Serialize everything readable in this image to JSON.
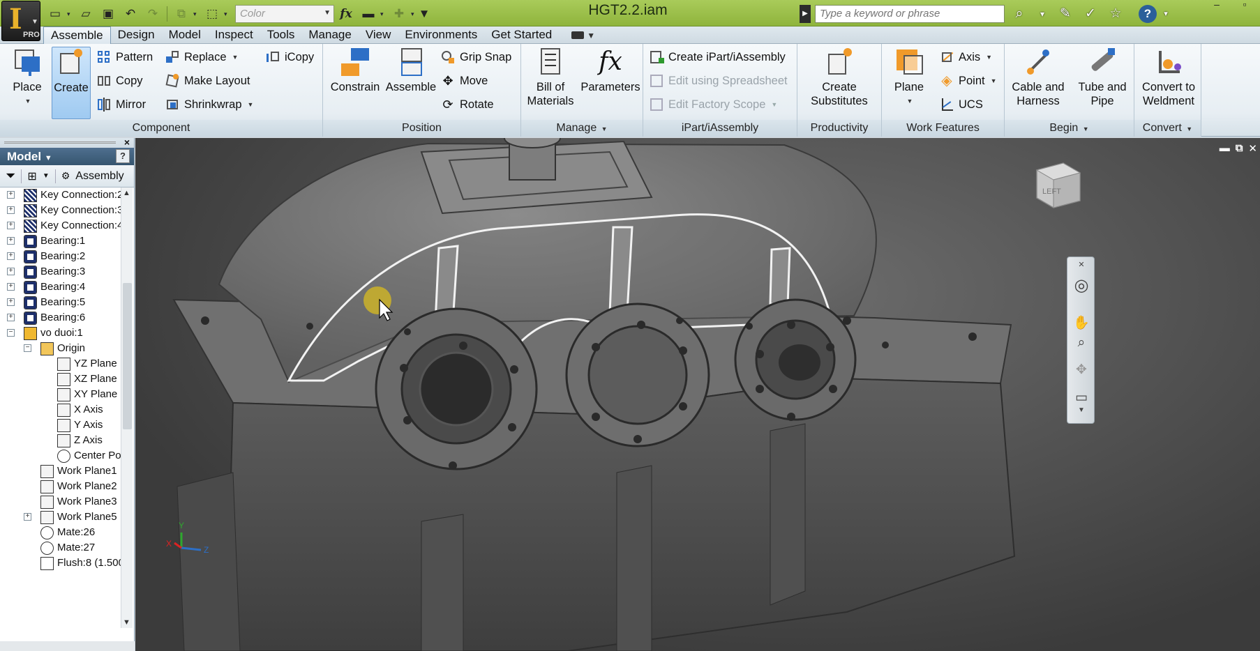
{
  "app": {
    "logo_letter": "I",
    "logo_badge": "PRO",
    "doc_title": "HGT2.2.iam"
  },
  "quick_access": {
    "color_placeholder": "Color",
    "fx": "fx"
  },
  "help": {
    "search_placeholder": "Type a keyword or phrase",
    "help_glyph": "?"
  },
  "window_controls": {
    "minimize": "–",
    "maximize": "▫"
  },
  "menu_tabs": [
    {
      "label": "Assemble",
      "active": true
    },
    {
      "label": "Design"
    },
    {
      "label": "Model"
    },
    {
      "label": "Inspect"
    },
    {
      "label": "Tools"
    },
    {
      "label": "Manage"
    },
    {
      "label": "View"
    },
    {
      "label": "Environments"
    },
    {
      "label": "Get Started"
    }
  ],
  "ribbon": {
    "component": {
      "label": "Component",
      "place": "Place",
      "create": "Create",
      "pattern": "Pattern",
      "copy": "Copy",
      "mirror": "Mirror",
      "replace": "Replace",
      "make_layout": "Make Layout",
      "shrinkwrap": "Shrinkwrap",
      "icopy": "iCopy"
    },
    "position": {
      "label": "Position",
      "constrain": "Constrain",
      "assemble": "Assemble",
      "grip_snap": "Grip Snap",
      "move": "Move",
      "rotate": "Rotate"
    },
    "manage": {
      "label": "Manage",
      "bom_line1": "Bill of",
      "bom_line2": "Materials",
      "parameters": "Parameters"
    },
    "ipart": {
      "label": "iPart/iAssembly",
      "create": "Create iPart/iAssembly",
      "edit_spreadsheet": "Edit using Spreadsheet",
      "edit_factory": "Edit Factory Scope"
    },
    "productivity": {
      "label": "Productivity",
      "line1": "Create",
      "line2": "Substitutes"
    },
    "work_features": {
      "label": "Work Features",
      "plane": "Plane",
      "axis": "Axis",
      "point": "Point",
      "ucs": "UCS"
    },
    "begin": {
      "label": "Begin",
      "cable_line1": "Cable and",
      "cable_line2": "Harness",
      "tube_line1": "Tube and",
      "tube_line2": "Pipe"
    },
    "convert": {
      "label": "Convert",
      "line1": "Convert to",
      "line2": "Weldment"
    }
  },
  "browser": {
    "title": "Model",
    "toolbar_label": "Assembly",
    "close": "×",
    "help_glyph": "?",
    "nodes": [
      {
        "label": "Key Connection:2",
        "icon": "key-connection-icon",
        "level": 0,
        "exp": "+"
      },
      {
        "label": "Key Connection:3",
        "icon": "key-connection-icon",
        "level": 0,
        "exp": "+"
      },
      {
        "label": "Key Connection:4",
        "icon": "key-connection-icon",
        "level": 0,
        "exp": "+"
      },
      {
        "label": "Bearing:1",
        "icon": "bearing-icon",
        "level": 0,
        "exp": "+"
      },
      {
        "label": "Bearing:2",
        "icon": "bearing-icon",
        "level": 0,
        "exp": "+"
      },
      {
        "label": "Bearing:3",
        "icon": "bearing-icon",
        "level": 0,
        "exp": "+"
      },
      {
        "label": "Bearing:4",
        "icon": "bearing-icon",
        "level": 0,
        "exp": "+"
      },
      {
        "label": "Bearing:5",
        "icon": "bearing-icon",
        "level": 0,
        "exp": "+"
      },
      {
        "label": "Bearing:6",
        "icon": "bearing-icon",
        "level": 0,
        "exp": "+"
      },
      {
        "label": "vo duoi:1",
        "icon": "part-icon",
        "level": 0,
        "exp": "−"
      },
      {
        "label": "Origin",
        "icon": "folder-icon",
        "level": 1,
        "exp": "−"
      },
      {
        "label": "YZ Plane",
        "icon": "plane-icon",
        "level": 2
      },
      {
        "label": "XZ Plane",
        "icon": "plane-icon",
        "level": 2
      },
      {
        "label": "XY Plane",
        "icon": "plane-icon",
        "level": 2
      },
      {
        "label": "X Axis",
        "icon": "axis-icon",
        "level": 2
      },
      {
        "label": "Y Axis",
        "icon": "axis-icon",
        "level": 2
      },
      {
        "label": "Z Axis",
        "icon": "axis-icon",
        "level": 2
      },
      {
        "label": "Center Poi",
        "icon": "point-icon",
        "level": 2
      },
      {
        "label": "Work Plane1",
        "icon": "plane-icon",
        "level": 1
      },
      {
        "label": "Work Plane2",
        "icon": "plane-icon",
        "level": 1
      },
      {
        "label": "Work Plane3",
        "icon": "plane-icon",
        "level": 1
      },
      {
        "label": "Work Plane5",
        "icon": "plane-icon",
        "level": 1,
        "exp": "+"
      },
      {
        "label": "Mate:26",
        "icon": "mate-icon",
        "level": 1
      },
      {
        "label": "Mate:27",
        "icon": "mate-icon",
        "level": 1
      },
      {
        "label": "Flush:8 (1.500",
        "icon": "flush-icon",
        "level": 1
      }
    ]
  },
  "viewcube": {
    "face_label": "LEFT"
  },
  "triad": {
    "x": "X",
    "y": "Y",
    "z": "Z"
  },
  "colors": {
    "accent": "#8fb43c",
    "selection": "#9fcaf1"
  }
}
